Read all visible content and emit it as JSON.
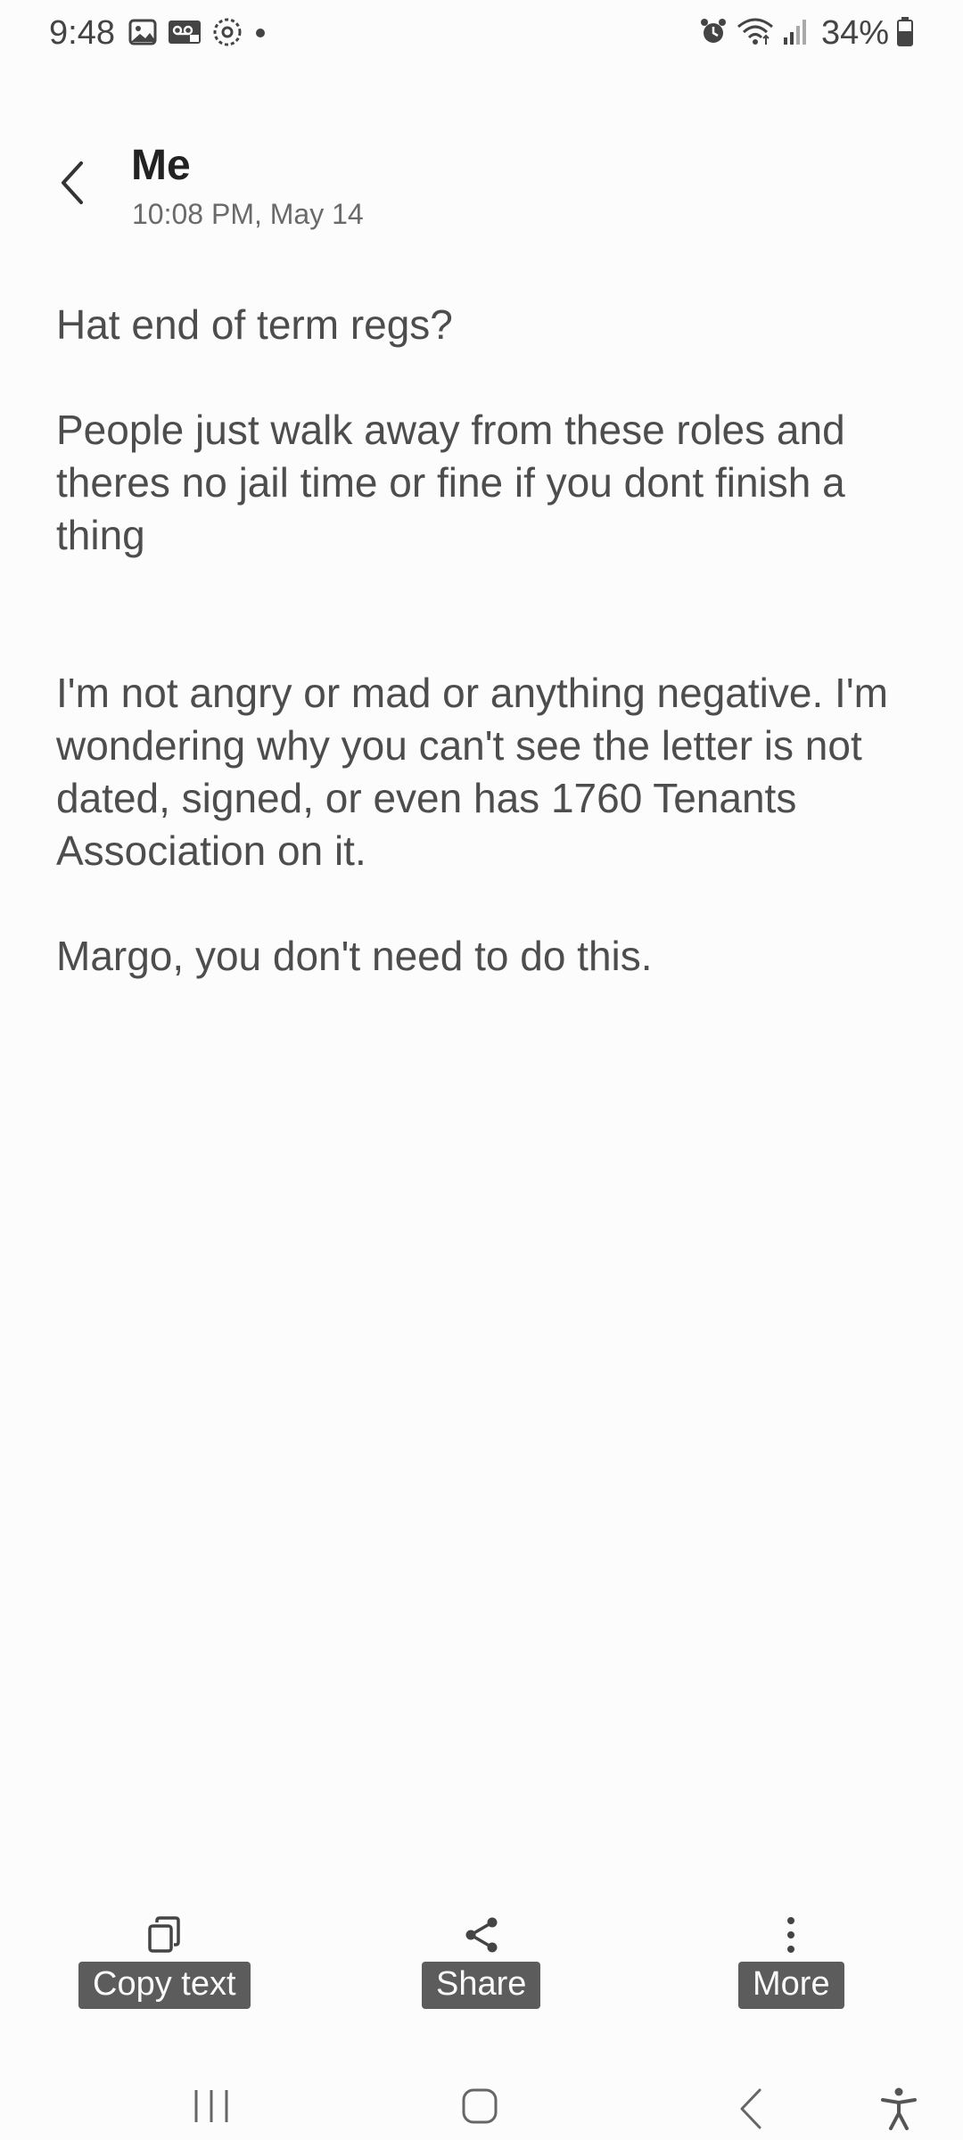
{
  "status_bar": {
    "time": "9:48",
    "left_icons": [
      "gallery-icon",
      "voicemail-icon",
      "sync-icon",
      "dot-icon"
    ],
    "right_icons": [
      "alarm-icon",
      "wifi-icon",
      "signal-icon"
    ],
    "battery_percent": "34%"
  },
  "header": {
    "title": "Me",
    "timestamp": "10:08 PM, May 14"
  },
  "message": {
    "paragraphs": [
      "Hat end of term regs?",
      "People just walk away from these roles and theres no jail time or fine if you dont finish a thing",
      "I'm not angry or mad or anything negative. I'm wondering why you can't see the letter is not dated, signed, or even has 1760 Tenants Association on it.",
      "Margo, you don't need to do this."
    ]
  },
  "actions": {
    "copy_label": "Copy text",
    "share_label": "Share",
    "more_label": "More"
  },
  "nav": {
    "buttons": [
      "recents-icon",
      "home-icon",
      "back-icon",
      "accessibility-icon"
    ]
  },
  "colors": {
    "background": "#fcfcfc",
    "text": "#4d4d4d",
    "label_bg": "#5c5c5c"
  }
}
